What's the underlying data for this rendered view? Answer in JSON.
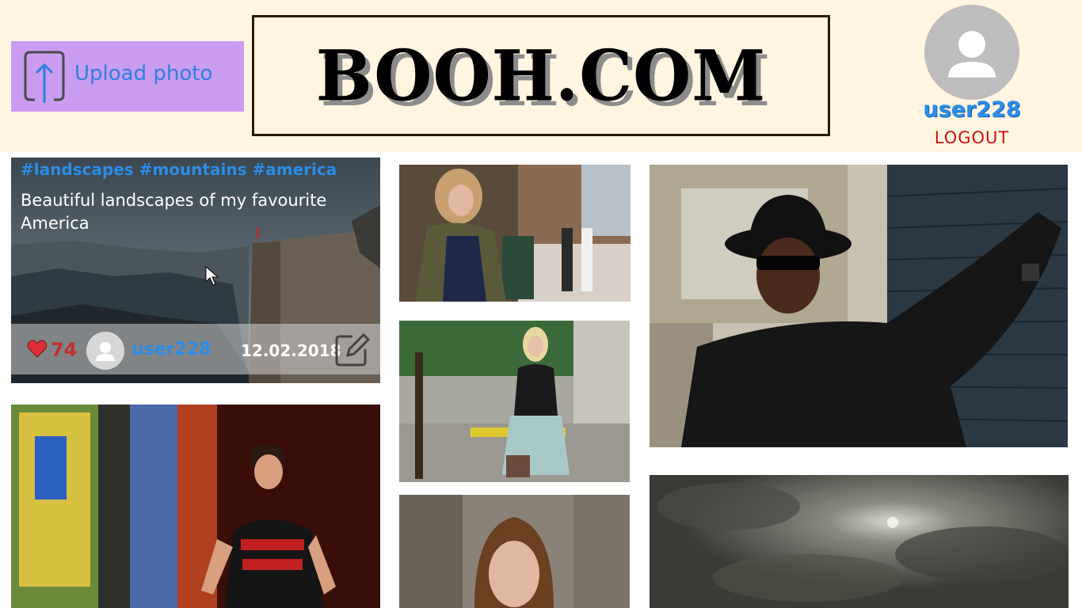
{
  "header": {
    "upload_label": "Upload photo",
    "upload_icon": "upload-icon",
    "logo": "BOOH.COM",
    "username": "user228",
    "logout_label": "LOGOUT"
  },
  "featured_post": {
    "tags": "#landscapes #mountains #america",
    "title": "Beautiful landscapes of my favourite America",
    "likes": "74",
    "author": "user228",
    "date": "12.02.2018",
    "icons": [
      "heart-icon",
      "user-avatar-icon",
      "edit-icon"
    ]
  },
  "colors": {
    "header_bg": "#fff5e1",
    "upload_bg": "#c99cf0",
    "link_blue": "#2a8de8",
    "logout_red": "#d11010",
    "likes_red": "#c43030"
  }
}
